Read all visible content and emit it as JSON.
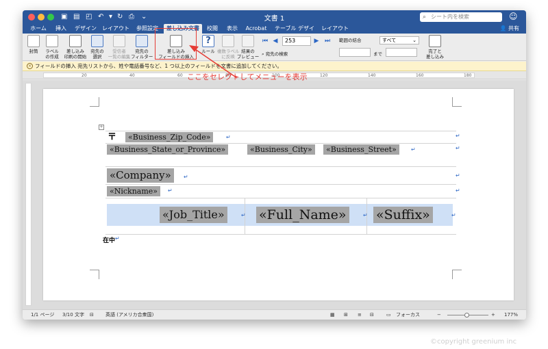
{
  "window": {
    "title": "文書 1",
    "search_placeholder": "シート内を検索"
  },
  "tabs": [
    "ホーム",
    "挿入",
    "デザイン",
    "レイアウト",
    "参照設定",
    "差し込み文書",
    "校閲",
    "表示",
    "Acrobat",
    "テーブル デザイン",
    "レイアウト"
  ],
  "share_label": "共有",
  "ribbon": {
    "envelope": "封筒",
    "labels": "ラベル\nの作成",
    "start_merge": "差し込み\n印刷の開始",
    "select_recipients": "宛先の\n選択",
    "edit_recipients": "受信者\n一覧の編集",
    "filter": "宛先の\nフィルター",
    "insert_field": "差し込み\nフィールドの挿入",
    "rules": "ルール",
    "update_labels": "複数ラベル\nに反映",
    "preview": "結果の\nプレビュー",
    "find_recipient": "宛先の検索",
    "record_number": "253",
    "range_label": "範囲の結合",
    "range_value": "すべて",
    "to_label": "まで",
    "finish_merge": "完了と\n差し込み"
  },
  "message_bar": "フィールドの挿入 宛先リストから、姓や電話番号など、1 つ以上のフィールドを文書に追加してください。",
  "annotation": "ここをセレクトしてメニューを表示",
  "ruler_numbers": [
    "20",
    "40",
    "60",
    "80",
    "100",
    "120",
    "140",
    "160",
    "180"
  ],
  "merge_fields": {
    "zip_mark": "〒",
    "zip": "«Business_Zip_Code»",
    "state": "«Business_State_or_Province»",
    "city": "«Business_City»",
    "street": "«Business_Street»",
    "company": "«Company»",
    "nickname": "«Nickname»",
    "job_title": "«Job_Title»",
    "full_name": "«Full_Name»",
    "suffix": "«Suffix»",
    "zaichu": "在中"
  },
  "status": {
    "page": "1/1 ページ",
    "words": "3/10 文字",
    "language": "英語 (アメリカ合衆国)",
    "focus": "フォーカス",
    "zoom": "177%"
  },
  "copyright": "©copyright greenium inc"
}
